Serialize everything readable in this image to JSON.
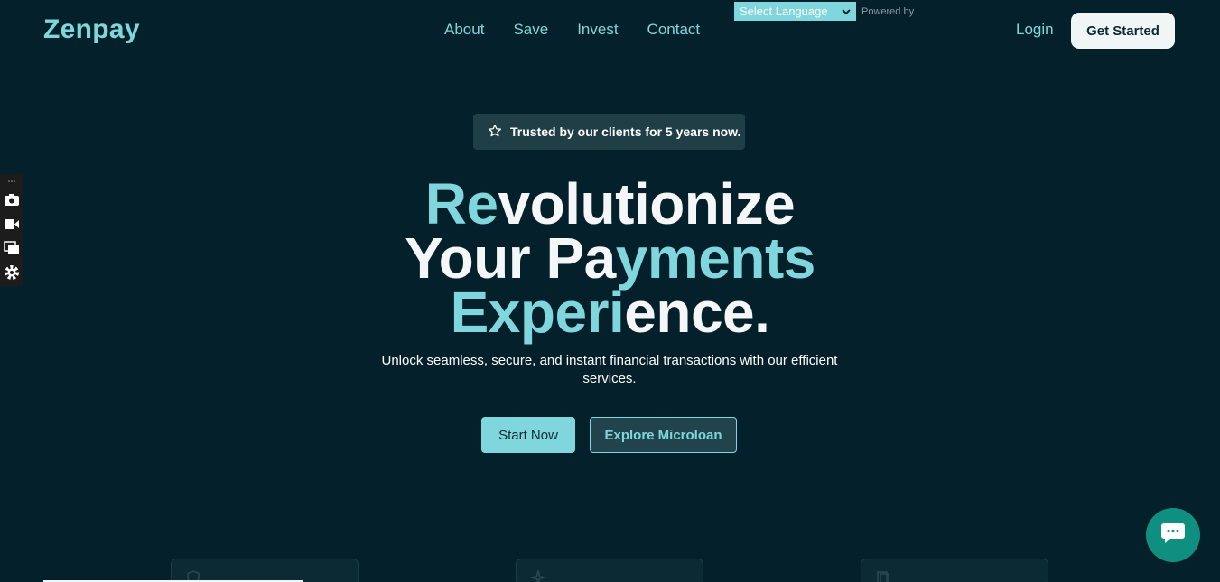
{
  "brand": {
    "name": "Zenpay"
  },
  "nav": {
    "items": [
      "About",
      "Save",
      "Invest",
      "Contact"
    ]
  },
  "translate": {
    "select_label": "Select Language",
    "powered_by": "Powered by"
  },
  "header": {
    "login": "Login",
    "get_started": "Get Started"
  },
  "hero": {
    "badge": "Trusted by our clients for 5 years now.",
    "line1_a": "Re",
    "line1_b": "volutionize",
    "line2_a": "Your Pa",
    "line2_b": "yments",
    "line3_a": "Experi",
    "line3_b": "ence.",
    "subtitle": "Unlock seamless, secure, and instant financial transactions with our efficient services.",
    "start_button": "Start Now",
    "explore_button": "Explore Microloan"
  },
  "colors": {
    "background": "#04202a",
    "accent": "#7fd6dc",
    "chat": "#0f8f80"
  },
  "icons": [
    "star-icon",
    "chevron-down-icon",
    "camera-icon",
    "video-icon",
    "window-icon",
    "gear-icon",
    "chat-icon",
    "shield-icon",
    "sparkle-icon",
    "document-icon"
  ]
}
